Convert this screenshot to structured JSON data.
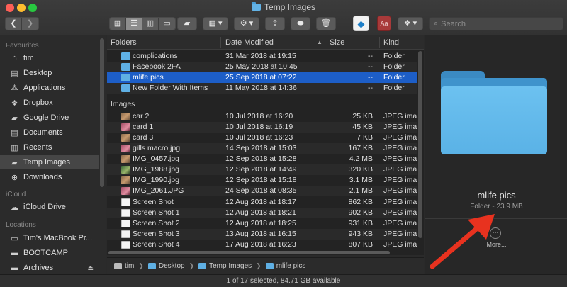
{
  "window": {
    "title": "Temp Images"
  },
  "toolbar": {
    "back_icon": "chevron-left-icon",
    "forward_icon": "chevron-right-icon",
    "search_placeholder": "Search",
    "colors": {
      "toolbar_bg": "#3a3a3a",
      "button_bg": "#5a5a5a",
      "active_view": "#8d8d8d"
    }
  },
  "sidebar": {
    "favourites_heading": "Favourites",
    "favourites": [
      {
        "label": "tim",
        "icon": "home-icon"
      },
      {
        "label": "Desktop",
        "icon": "desktop-icon"
      },
      {
        "label": "Applications",
        "icon": "applications-icon"
      },
      {
        "label": "Dropbox",
        "icon": "dropbox-icon"
      },
      {
        "label": "Google Drive",
        "icon": "folder-icon"
      },
      {
        "label": "Documents",
        "icon": "documents-icon"
      },
      {
        "label": "Recents",
        "icon": "recents-icon"
      },
      {
        "label": "Temp Images",
        "icon": "folder-icon",
        "selected": true
      },
      {
        "label": "Downloads",
        "icon": "downloads-icon"
      }
    ],
    "icloud_heading": "iCloud",
    "icloud": [
      {
        "label": "iCloud Drive",
        "icon": "cloud-icon"
      }
    ],
    "locations_heading": "Locations",
    "locations": [
      {
        "label": "Tim's MacBook Pr...",
        "icon": "laptop-icon"
      },
      {
        "label": "BOOTCAMP",
        "icon": "disk-icon"
      },
      {
        "label": "Archives",
        "icon": "disk-icon",
        "eject": "⏏"
      }
    ]
  },
  "list": {
    "columns": {
      "name": "Folders",
      "date": "Date Modified",
      "size": "Size",
      "kind": "Kind"
    },
    "folders": [
      {
        "name": "complications",
        "date": "31 Mar 2018 at 19:15",
        "size": "--",
        "kind": "Folder"
      },
      {
        "name": "Facebook 2FA",
        "date": "25 May 2018 at 10:45",
        "size": "--",
        "kind": "Folder"
      },
      {
        "name": "mlife pics",
        "date": "25 Sep 2018 at 07:22",
        "size": "--",
        "kind": "Folder",
        "selected": true
      },
      {
        "name": "New Folder With Items",
        "date": "11 May 2018 at 14:36",
        "size": "--",
        "kind": "Folder"
      }
    ],
    "images_heading": "Images",
    "images": [
      {
        "name": "car 2",
        "date": "10 Jul 2018 at 16:20",
        "size": "25 KB",
        "kind": "JPEG image",
        "thumb": "photo"
      },
      {
        "name": "card 1",
        "date": "10 Jul 2018 at 16:19",
        "size": "45 KB",
        "kind": "JPEG image",
        "thumb": "pink"
      },
      {
        "name": "card 3",
        "date": "10 Jul 2018 at 16:23",
        "size": "7 KB",
        "kind": "JPEG image",
        "thumb": "photo"
      },
      {
        "name": "gills macro.jpg",
        "date": "14 Sep 2018 at 15:03",
        "size": "167 KB",
        "kind": "JPEG image",
        "thumb": "pink"
      },
      {
        "name": "IMG_0457.jpg",
        "date": "12 Sep 2018 at 15:28",
        "size": "4.2 MB",
        "kind": "JPEG image",
        "thumb": "photo"
      },
      {
        "name": "IMG_1988.jpg",
        "date": "12 Sep 2018 at 14:49",
        "size": "320 KB",
        "kind": "JPEG image",
        "thumb": "green"
      },
      {
        "name": "IMG_1990.jpg",
        "date": "12 Sep 2018 at 15:18",
        "size": "3.1 MB",
        "kind": "JPEG image",
        "thumb": "photo"
      },
      {
        "name": "IMG_2061.JPG",
        "date": "24 Sep 2018 at 08:35",
        "size": "2.1 MB",
        "kind": "JPEG image",
        "thumb": "pink"
      },
      {
        "name": "Screen Shot",
        "date": "12 Aug 2018 at 18:17",
        "size": "862 KB",
        "kind": "JPEG image",
        "thumb": "doc"
      },
      {
        "name": "Screen Shot 1",
        "date": "12 Aug 2018 at 18:21",
        "size": "902 KB",
        "kind": "JPEG image",
        "thumb": "doc"
      },
      {
        "name": "Screen Shot 2",
        "date": "12 Aug 2018 at 18:25",
        "size": "931 KB",
        "kind": "JPEG image",
        "thumb": "doc"
      },
      {
        "name": "Screen Shot 3",
        "date": "13 Aug 2018 at 16:15",
        "size": "943 KB",
        "kind": "JPEG image",
        "thumb": "doc"
      },
      {
        "name": "Screen Shot 4",
        "date": "17 Aug 2018 at 16:23",
        "size": "807 KB",
        "kind": "JPEG image",
        "thumb": "doc"
      }
    ]
  },
  "pathbar": {
    "items": [
      "tim",
      "Desktop",
      "Temp Images",
      "mlife pics"
    ]
  },
  "status": {
    "text": "1 of 17 selected, 84.71 GB available"
  },
  "preview": {
    "name": "mlife pics",
    "meta": "Folder - 23.9 MB",
    "more_label": "More...",
    "more_glyph": "···",
    "folder_color": "#5ab2e6"
  },
  "colors": {
    "selection": "#1d5ec7",
    "annotation_arrow": "#e8321f"
  }
}
